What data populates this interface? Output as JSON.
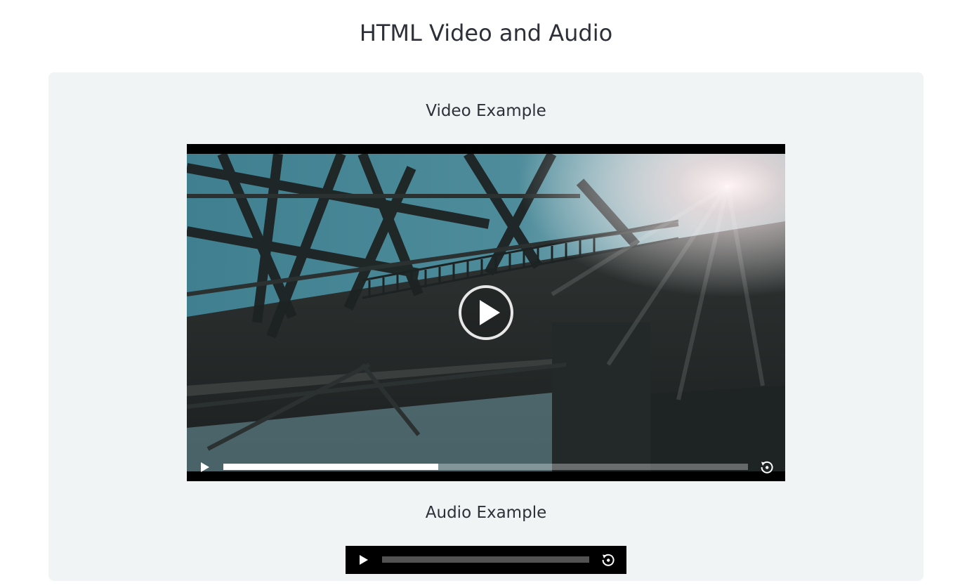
{
  "page": {
    "title": "HTML Video and Audio"
  },
  "video_section": {
    "heading": "Video Example",
    "player": {
      "progress": 0.41,
      "icons": {
        "big_play": "play-circle-icon",
        "play": "play-icon",
        "replay": "replay-icon"
      }
    }
  },
  "audio_section": {
    "heading": "Audio Example",
    "player": {
      "progress": 0,
      "icons": {
        "play": "play-icon",
        "replay": "replay-icon"
      }
    }
  },
  "colors": {
    "card_background": "#f1f4f5",
    "text": "#2d3038",
    "player_background": "#000000",
    "progress_fill": "#ffffff"
  }
}
